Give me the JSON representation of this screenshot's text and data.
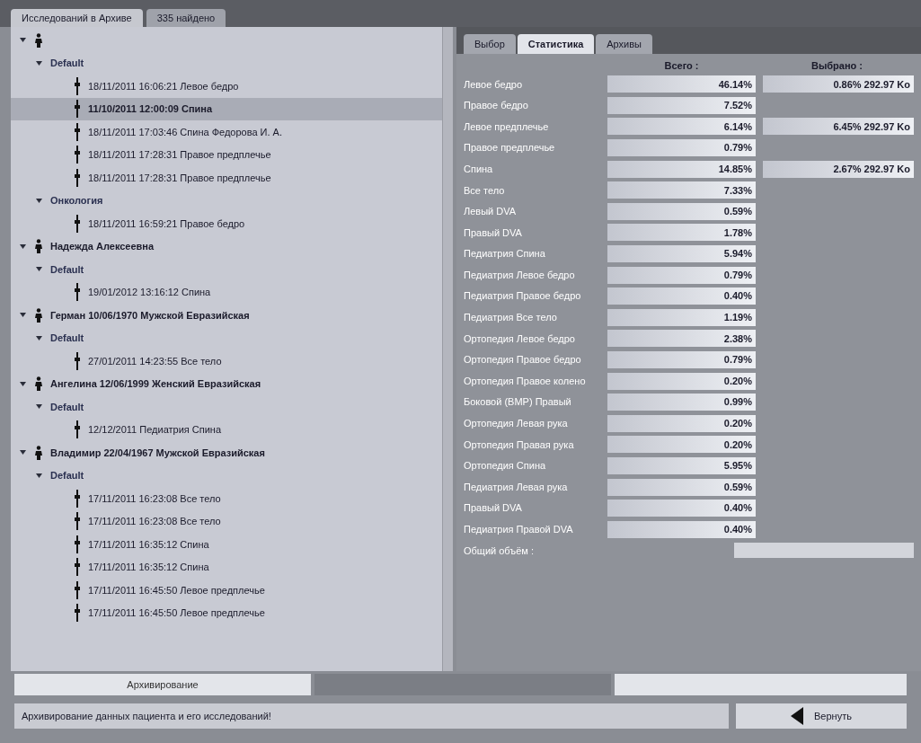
{
  "header": {
    "title": "Исследований в Архиве",
    "count": "335 найдено"
  },
  "tree": [
    {
      "expanded": true,
      "children": [
        {
          "label": "Default",
          "expanded": true,
          "children": [
            {
              "label": "18/11/2011 16:06:21 Левое бедро",
              "selected": false
            },
            {
              "label": "11/10/2011 12:00:09 Спина",
              "selected": true
            },
            {
              "label": "18/11/2011 17:03:46 Спина Федорова И. А.",
              "selected": false
            },
            {
              "label": "18/11/2011 17:28:31 Правое предплечье",
              "selected": false
            },
            {
              "label": "18/11/2011 17:28:31 Правое предплечье",
              "selected": false
            }
          ]
        },
        {
          "label": "Онкология",
          "expanded": true,
          "children": [
            {
              "label": "18/11/2011 16:59:21 Правое бедро",
              "selected": false
            }
          ]
        }
      ]
    },
    {
      "patient": "Надежда Алексеевна",
      "expanded": true,
      "children": [
        {
          "label": "Default",
          "expanded": true,
          "children": [
            {
              "label": "19/01/2012 13:16:12 Спина",
              "selected": false
            }
          ]
        }
      ]
    },
    {
      "patient": "Герман 10/06/1970 Мужской Евразийская",
      "expanded": true,
      "children": [
        {
          "label": "Default",
          "expanded": true,
          "children": [
            {
              "label": "27/01/2011 14:23:55 Все тело",
              "selected": false
            }
          ]
        }
      ]
    },
    {
      "patient": "Ангелина 12/06/1999 Женский Евразийская",
      "expanded": true,
      "children": [
        {
          "label": "Default",
          "expanded": true,
          "children": [
            {
              "label": "12/12/2011 Педиатрия Спина",
              "selected": false
            }
          ]
        }
      ]
    },
    {
      "patient": "Владимир 22/04/1967 Мужской Евразийская",
      "expanded": true,
      "children": [
        {
          "label": "Default",
          "expanded": true,
          "children": [
            {
              "label": "17/11/2011 16:23:08 Все тело",
              "selected": false
            },
            {
              "label": "17/11/2011 16:23:08 Все тело",
              "selected": false
            },
            {
              "label": "17/11/2011 16:35:12 Спина",
              "selected": false
            },
            {
              "label": "17/11/2011 16:35:12 Спина",
              "selected": false
            },
            {
              "label": "17/11/2011 16:45:50 Левое предплечье",
              "selected": false
            },
            {
              "label": "17/11/2011 16:45:50 Левое предплечье",
              "selected": false
            }
          ]
        }
      ]
    }
  ],
  "tabs": [
    {
      "label": "Выбор",
      "selected": false
    },
    {
      "label": "Статистика",
      "selected": true
    },
    {
      "label": "Архивы",
      "selected": false
    }
  ],
  "stats": {
    "columns": [
      "Всего :",
      "Выбрано :"
    ],
    "rows": [
      {
        "label": "Левое бедро",
        "total": "46.14%",
        "selected": "0.86% 292.97 Ko"
      },
      {
        "label": "Правое бедро",
        "total": "7.52%"
      },
      {
        "label": "Левое предплечье",
        "total": "6.14%",
        "selected": "6.45% 292.97 Ko"
      },
      {
        "label": "Правое предплечье",
        "total": "0.79%"
      },
      {
        "label": "Спина",
        "total": "14.85%",
        "selected": "2.67% 292.97 Ko"
      },
      {
        "label": "Все тело",
        "total": "7.33%"
      },
      {
        "label": "Левый DVA",
        "total": "0.59%"
      },
      {
        "label": "Правый DVA",
        "total": "1.78%"
      },
      {
        "label": "Педиатрия Спина",
        "total": "5.94%"
      },
      {
        "label": "Педиатрия Левое бедро",
        "total": "0.79%"
      },
      {
        "label": "Педиатрия Правое бедро",
        "total": "0.40%"
      },
      {
        "label": "Педиатрия Все тело",
        "total": "1.19%"
      },
      {
        "label": "Ортопедия Левое бедро",
        "total": "2.38%"
      },
      {
        "label": "Ортопедия Правое бедро",
        "total": "0.79%"
      },
      {
        "label": "Ортопедия Правое колено",
        "total": "0.20%"
      },
      {
        "label": "Боковой (ВМР) Правый",
        "total": "0.99%"
      },
      {
        "label": "Ортопедия Левая рука",
        "total": "0.20%"
      },
      {
        "label": "Ортопедия Правая рука",
        "total": "0.20%"
      },
      {
        "label": "Ортопедия Спина",
        "total": "5.95%"
      },
      {
        "label": "Педиатрия Левая рука",
        "total": "0.59%"
      },
      {
        "label": "Правый DVA",
        "total": "0.40%"
      },
      {
        "label": "Педиатрия Правой DVA",
        "total": "0.40%"
      }
    ],
    "total_label": "Общий объём :"
  },
  "buttons": [
    {
      "label": "Архивирование"
    }
  ],
  "status": "Архивирование данных пациента и его исследований!",
  "back_button": "Вернуть"
}
